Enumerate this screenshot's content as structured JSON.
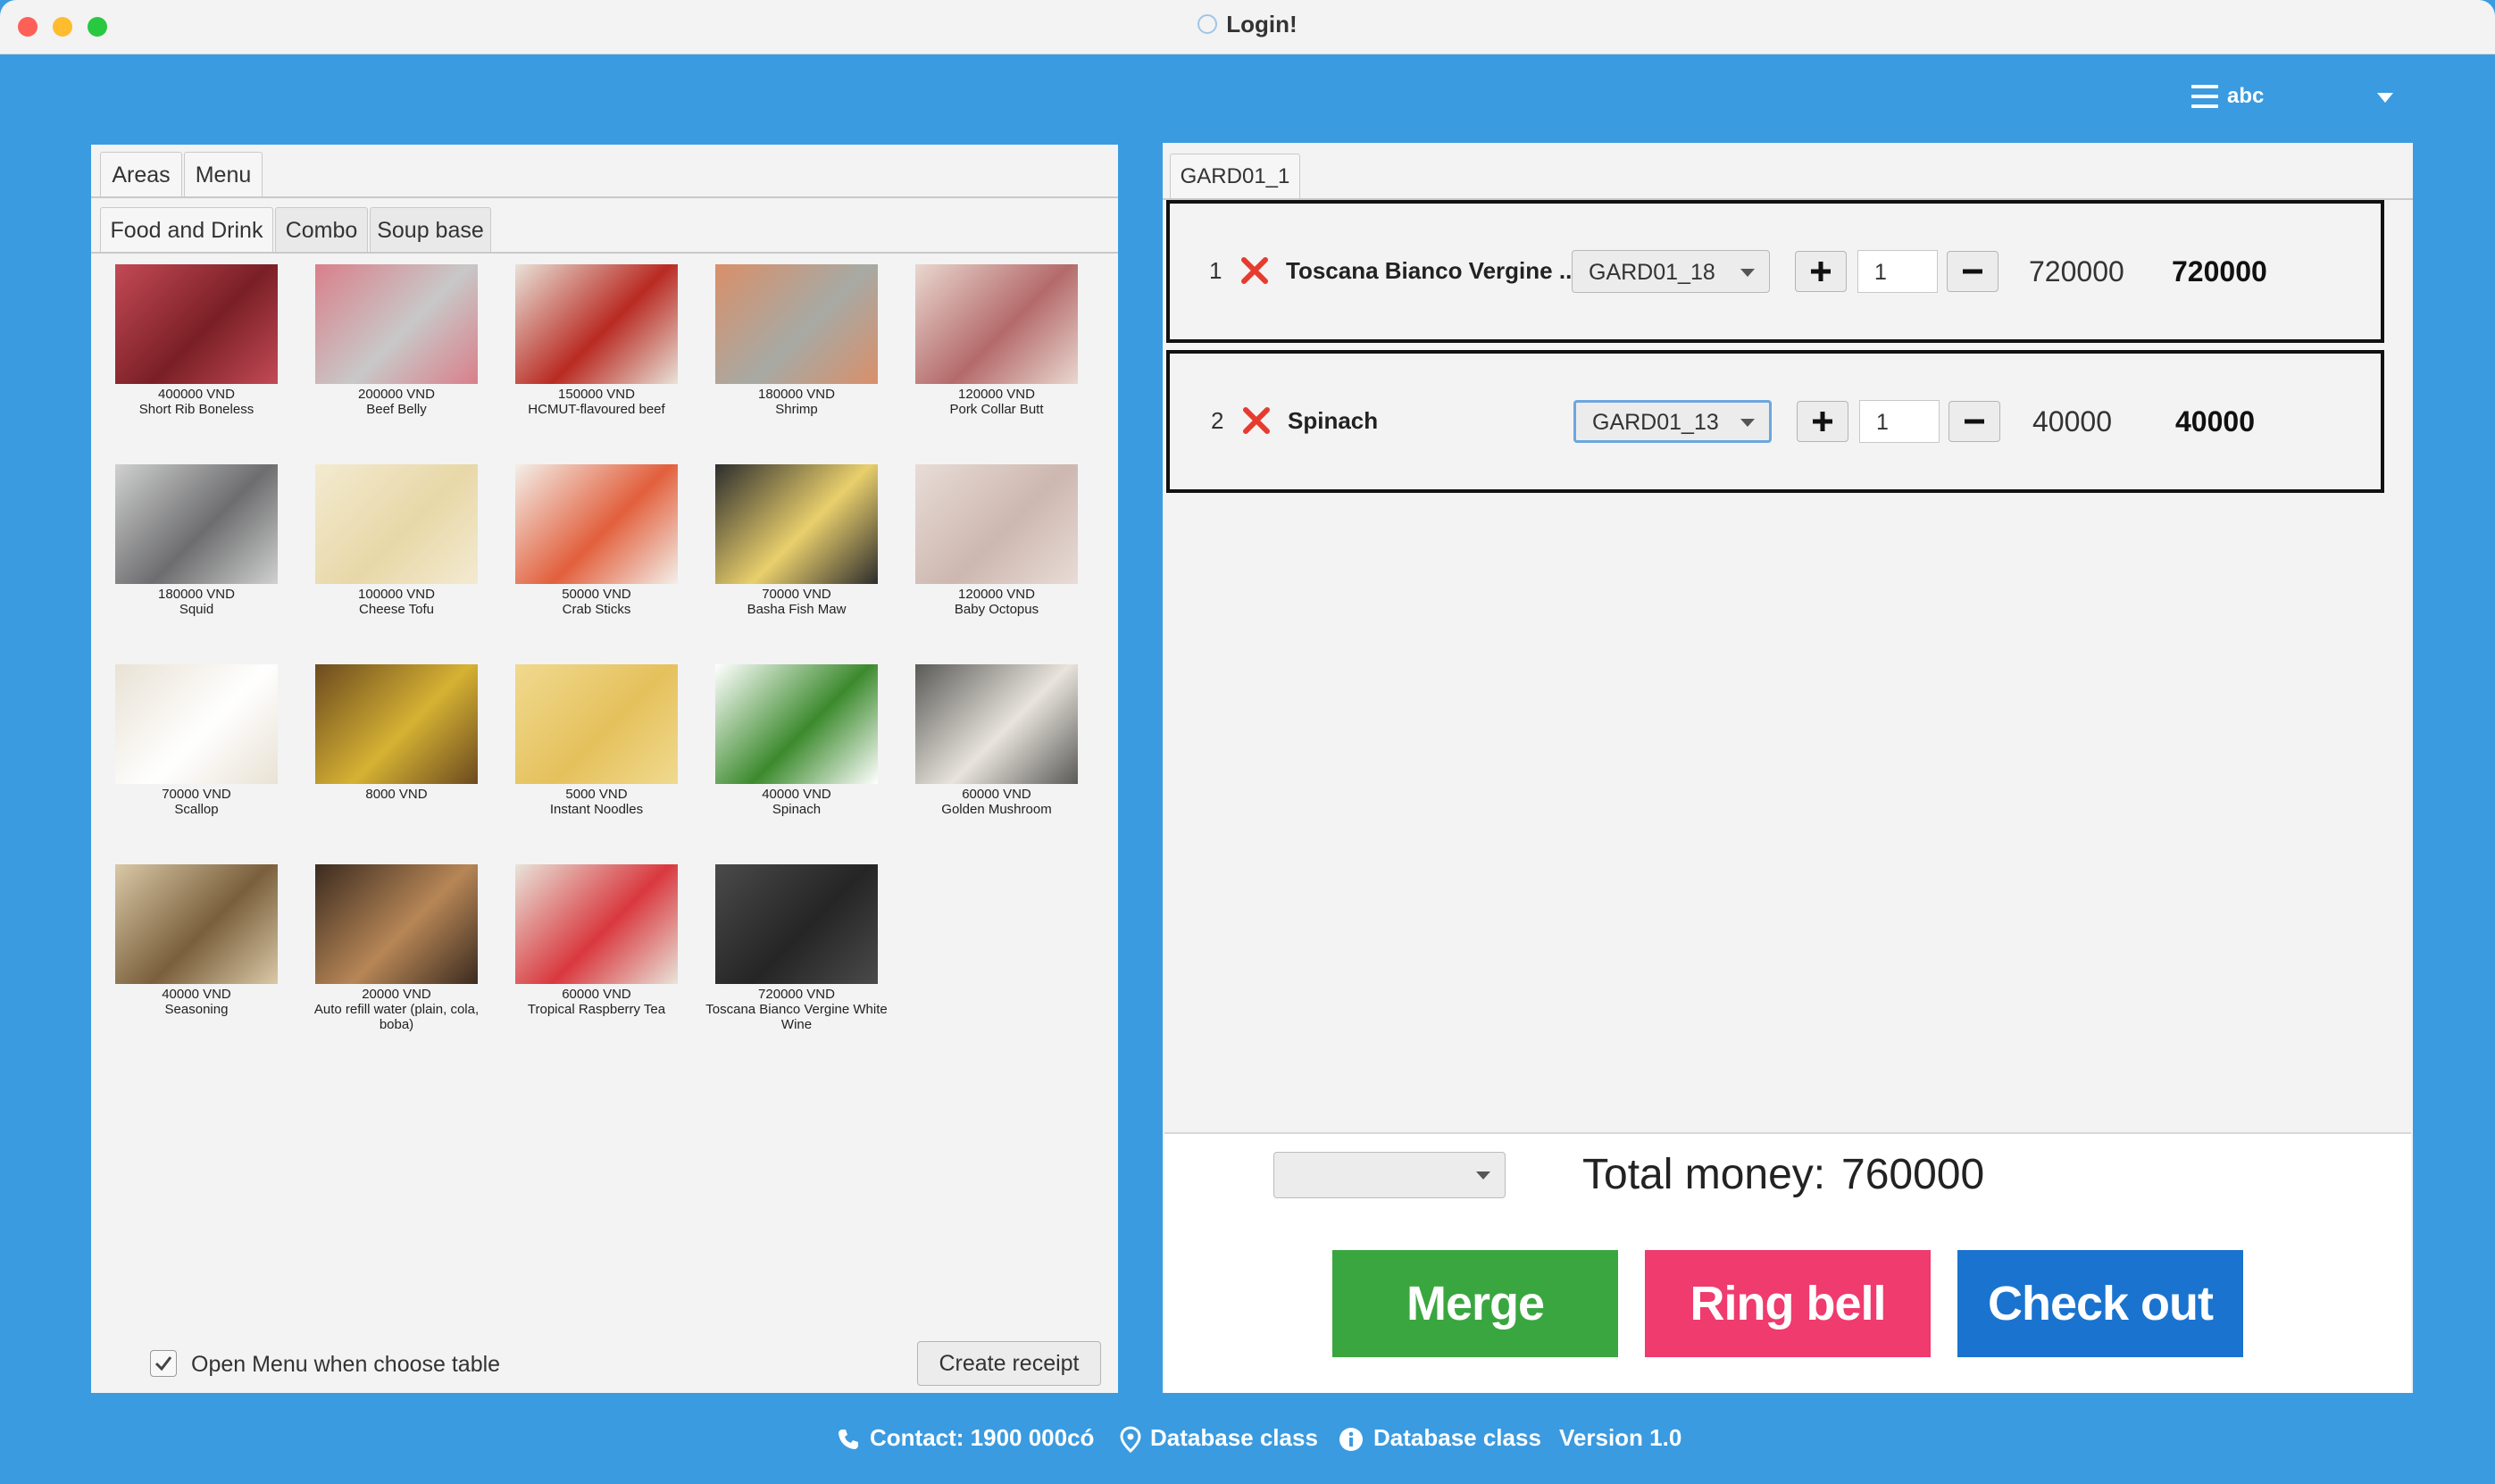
{
  "window": {
    "title": "Login!"
  },
  "user": {
    "name": "abc"
  },
  "left_panel": {
    "main_tabs": [
      "Areas",
      "Menu"
    ],
    "sub_tabs": [
      "Food and Drink",
      "Combo",
      "Soup base"
    ],
    "items": [
      {
        "price": "400000 VND",
        "name": "Short Rib Boneless",
        "icon": "short-rib-image"
      },
      {
        "price": "200000 VND",
        "name": "Beef Belly",
        "icon": "beef-belly-image"
      },
      {
        "price": "150000 VND",
        "name": "HCMUT-flavoured beef",
        "icon": "hcmut-beef-image"
      },
      {
        "price": "180000 VND",
        "name": "Shrimp",
        "icon": "shrimp-image"
      },
      {
        "price": "120000 VND",
        "name": "Pork Collar Butt",
        "icon": "pork-collar-image"
      },
      {
        "price": "180000 VND",
        "name": "Squid",
        "icon": "squid-image"
      },
      {
        "price": "100000 VND",
        "name": "Cheese Tofu",
        "icon": "cheese-tofu-image"
      },
      {
        "price": "50000 VND",
        "name": "Crab Sticks",
        "icon": "crab-sticks-image"
      },
      {
        "price": "70000 VND",
        "name": "Basha Fish Maw",
        "icon": "fish-maw-image"
      },
      {
        "price": "120000 VND",
        "name": "Baby Octopus",
        "icon": "baby-octopus-image"
      },
      {
        "price": "70000 VND",
        "name": "Scallop",
        "icon": "scallop-image"
      },
      {
        "price": "8000 VND",
        "name": "",
        "icon": "corn-image"
      },
      {
        "price": "5000 VND",
        "name": "Instant Noodles",
        "icon": "instant-noodles-image"
      },
      {
        "price": "40000 VND",
        "name": "Spinach",
        "icon": "spinach-image"
      },
      {
        "price": "60000 VND",
        "name": "Golden Mushroom",
        "icon": "golden-mushroom-image"
      },
      {
        "price": "40000 VND",
        "name": "Seasoning",
        "icon": "seasoning-image"
      },
      {
        "price": "20000 VND",
        "name": "Auto refill water (plain, cola, boba)",
        "icon": "auto-refill-water-image"
      },
      {
        "price": "60000 VND",
        "name": "Tropical Raspberry Tea",
        "icon": "raspberry-tea-image"
      },
      {
        "price": "720000 VND",
        "name": "Toscana Bianco Vergine White Wine",
        "icon": "white-wine-image"
      }
    ],
    "open_menu_label": "Open Menu when choose table",
    "open_menu_checked": true,
    "create_receipt_label": "Create receipt"
  },
  "right_panel": {
    "table_tab": "GARD01_1",
    "order_rows": [
      {
        "index": "1",
        "name": "Toscana Bianco Vergine ...",
        "table": "GARD01_18",
        "qty": "1",
        "unit_price": "720000",
        "total": "720000"
      },
      {
        "index": "2",
        "name": "Spinach",
        "table": "GARD01_13",
        "qty": "1",
        "unit_price": "40000",
        "total": "40000"
      }
    ],
    "discount_select": "",
    "total_label": "Total money:",
    "total_value": "760000",
    "buttons": {
      "merge": "Merge",
      "ring_bell": "Ring bell",
      "checkout": "Check out"
    }
  },
  "footer": {
    "contact": "Contact: 1900 000có",
    "location": "Database class",
    "info": "Database class",
    "version": "Version 1.0"
  },
  "colors": {
    "background": "#3a9be0",
    "merge": "#3aa63f",
    "ring_bell": "#ef3b6e",
    "checkout": "#1a73cf",
    "remove_x": "#e63b2e"
  }
}
